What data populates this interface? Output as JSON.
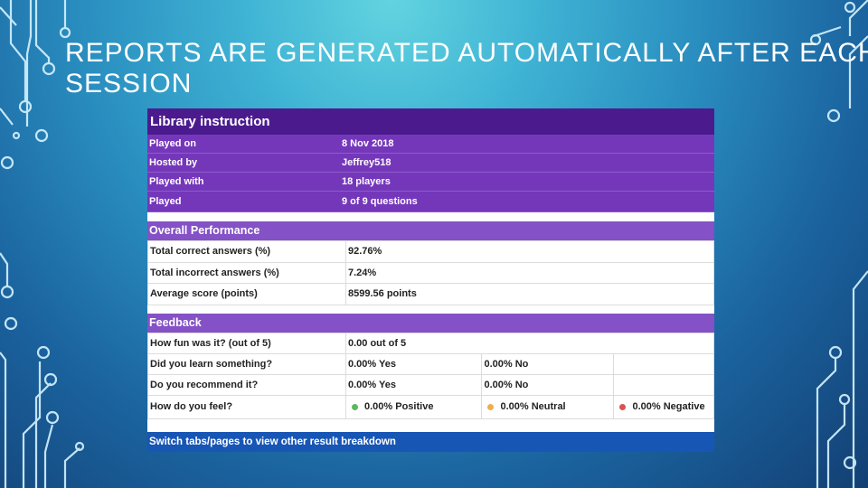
{
  "slide": {
    "title_line1": "REPORTS ARE GENERATED AUTOMATICALLY AFTER EACH",
    "title_line2": "SESSION"
  },
  "report": {
    "title": "Library instruction",
    "meta": [
      {
        "label": "Played on",
        "value": "8 Nov 2018"
      },
      {
        "label": "Hosted by",
        "value": "Jeffrey518"
      },
      {
        "label": "Played with",
        "value": "18 players"
      },
      {
        "label": "Played",
        "value": "9 of 9 questions"
      }
    ],
    "overall": {
      "heading": "Overall Performance",
      "rows": [
        {
          "label": "Total correct answers (%)",
          "value": "92.76%"
        },
        {
          "label": "Total incorrect answers (%)",
          "value": "7.24%"
        },
        {
          "label": "Average score (points)",
          "value": "8599.56 points"
        }
      ]
    },
    "feedback": {
      "heading": "Feedback",
      "fun": {
        "label": "How fun was it? (out of 5)",
        "value": "0.00 out of 5"
      },
      "learn": {
        "label": "Did you learn something?",
        "yes": "0.00% Yes",
        "no": "0.00% No"
      },
      "recommend": {
        "label": "Do you recommend it?",
        "yes": "0.00% Yes",
        "no": "0.00% No"
      },
      "feel": {
        "label": "How do you feel?",
        "positive": "0.00% Positive",
        "neutral": "0.00% Neutral",
        "negative": "0.00% Negative"
      }
    },
    "footer": "Switch tabs/pages to view other result breakdown"
  },
  "colors": {
    "header": "#4b1b8e",
    "meta_bg": "#7437ba",
    "section_bar": "#8451c6",
    "footer": "#1856b5",
    "positive_dot": "#5cb85c",
    "neutral_dot": "#f0ad4e",
    "negative_dot": "#d9534f"
  }
}
